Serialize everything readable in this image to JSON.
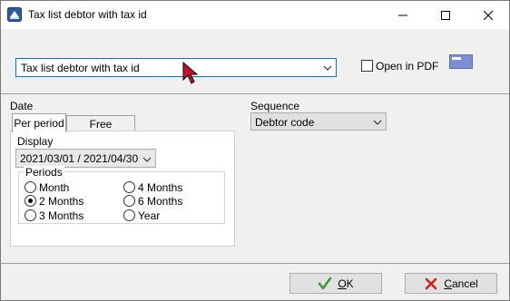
{
  "window": {
    "title": "Tax list debtor with tax id"
  },
  "report": {
    "selected": "Tax list debtor with tax id",
    "open_in_pdf_label": "Open in PDF",
    "open_in_pdf_checked": false
  },
  "date_section": {
    "label": "Date",
    "tabs": [
      "Per period",
      "Free selection"
    ],
    "active_tab": "Per period",
    "display_label": "Display",
    "display_value": "2021/03/01 / 2021/04/30",
    "periods_label": "Periods",
    "periods": [
      {
        "label": "Month",
        "checked": false
      },
      {
        "label": "2 Months",
        "checked": true
      },
      {
        "label": "3 Months",
        "checked": false
      },
      {
        "label": "4 Months",
        "checked": false
      },
      {
        "label": "6 Months",
        "checked": false
      },
      {
        "label": "Year",
        "checked": false
      }
    ]
  },
  "sequence": {
    "label": "Sequence",
    "value": "Debtor code"
  },
  "buttons": {
    "ok_first": "O",
    "ok_rest": "K",
    "cancel_first": "C",
    "cancel_rest": "ancel"
  },
  "icons": {
    "app": "app-icon",
    "pdf": "pdf-icon",
    "ok": "check-icon",
    "cancel": "x-icon",
    "cursor": "mouse-cursor-icon"
  },
  "colors": {
    "focus_border": "#0078d7",
    "ok_green": "#3c9a3c",
    "cancel_red": "#d21f1f",
    "cursor_red": "#c8102e"
  }
}
